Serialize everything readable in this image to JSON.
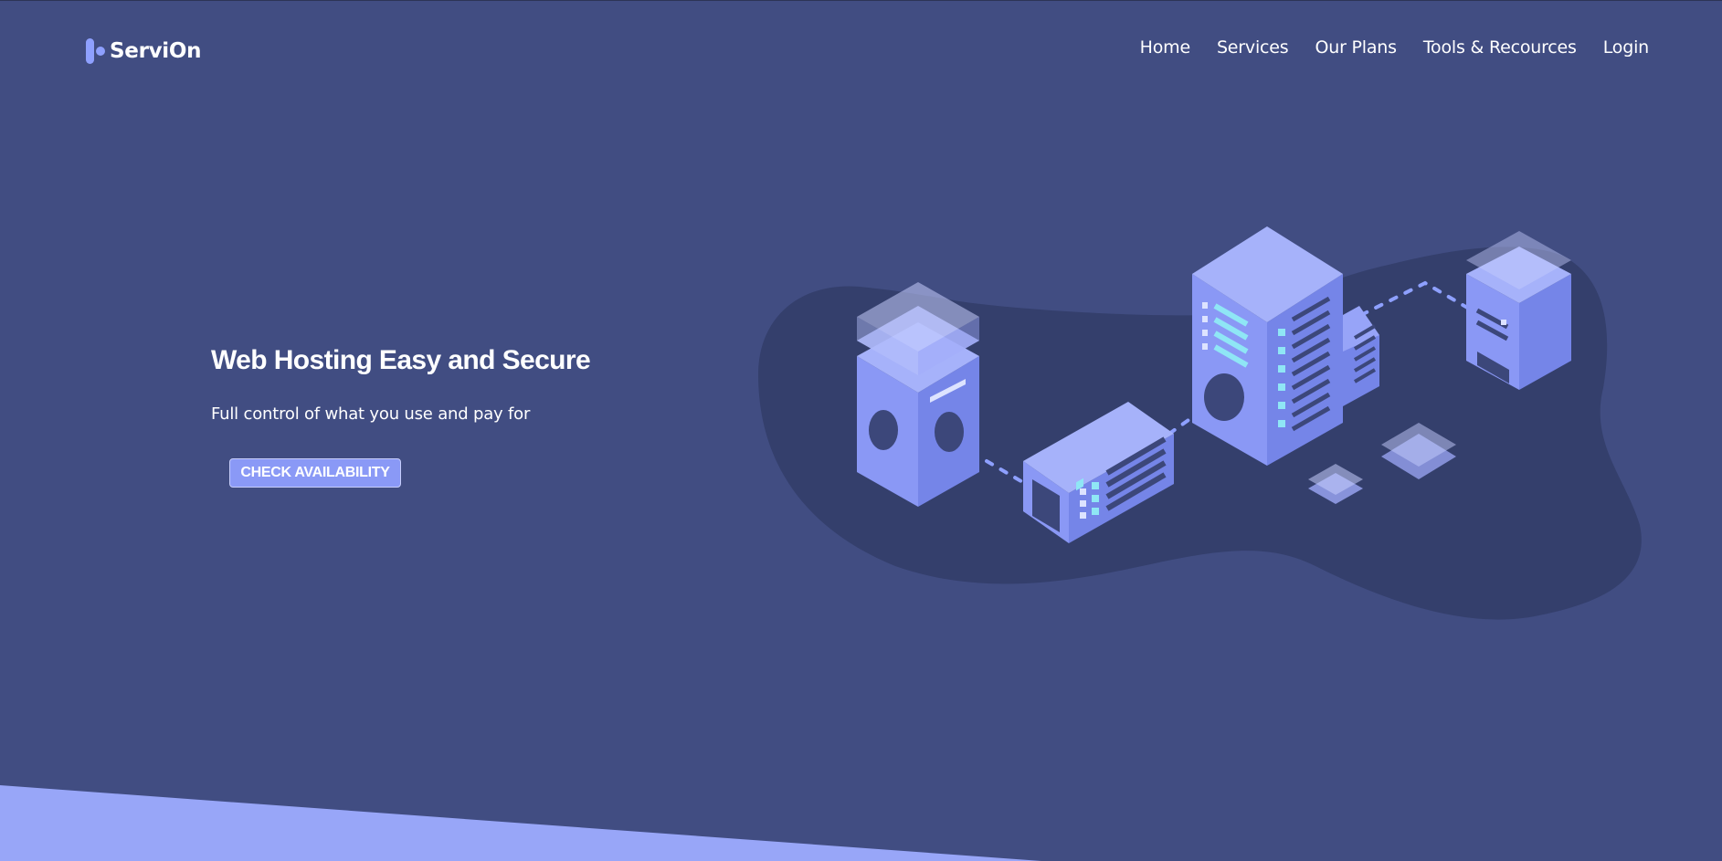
{
  "header": {
    "logo_text": "ServiOn",
    "nav": [
      {
        "label": "Home"
      },
      {
        "label": "Services"
      },
      {
        "label": "Our Plans"
      },
      {
        "label": "Tools & Recources"
      },
      {
        "label": "Login"
      }
    ]
  },
  "hero": {
    "title": "Web Hosting Easy and Secure",
    "subtitle": "Full control of what you use and pay for",
    "cta_label": "CHECK AVAILABILITY"
  },
  "illustration": {
    "name": "isometric-servers-illustration"
  },
  "colors": {
    "background": "#414d82",
    "accent": "#8a99f6",
    "blob": "#343f6c",
    "bottom_shape": "#98a6f8",
    "teal_lights": "#8fe6f5"
  }
}
